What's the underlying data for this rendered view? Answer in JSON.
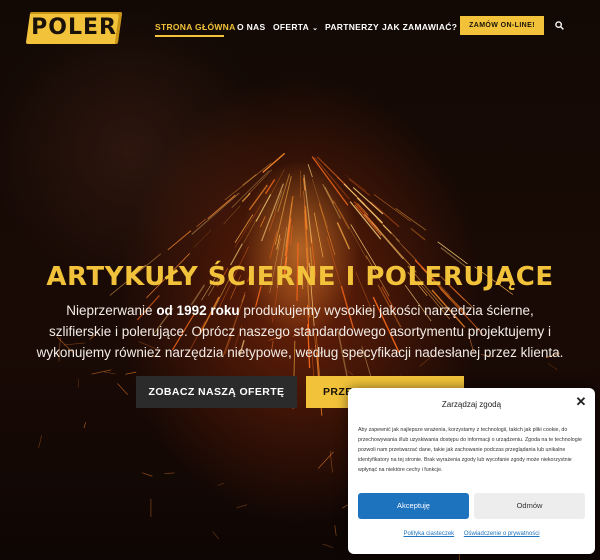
{
  "header": {
    "logo_text": "POLER",
    "nav": [
      {
        "label": "STRONA GŁÓWNA",
        "active": true
      },
      {
        "label": "O NAS"
      },
      {
        "label": "OFERTA",
        "has_dropdown": true
      },
      {
        "label": "PARTNERZY"
      },
      {
        "label": "JAK ZAMAWIAĆ?"
      }
    ],
    "order_button": "ZAMÓW ON-LINE!",
    "search_icon": "search-icon"
  },
  "hero": {
    "title": "ARTYKUŁY ŚCIERNE I POLERUJĄCE",
    "desc_before": "Nieprzerwanie ",
    "desc_bold": "od 1992 roku",
    "desc_after": " produkujemy wysokiej jakości narzędzia ścierne, szlifierskie i polerujące. Oprócz naszego standardowego asortymentu projektujemy i wykonujemy również narzędzia nietypowe, według specyfikacji nadesłanej przez klienta.",
    "button_offer": "ZOBACZ NASZĄ OFERTĘ",
    "button_second": "PRZE"
  },
  "consent": {
    "title": "Zarządzaj zgodą",
    "text": "Aby zapewnić jak najlepsze wrażenia, korzystamy z technologii, takich jak pliki cookie, do przechowywania i/lub uzyskiwania dostępu do informacji o urządzeniu. Zgoda na te technologie pozwoli nam przetwarzać dane, takie jak zachowanie podczas przeglądania lub unikalne identyfikatory na tej stronie. Brak wyrażenia zgody lub wycofanie zgody może niekorzystnie wpłynąć na niektóre cechy i funkcje.",
    "accept": "Akceptuję",
    "deny": "Odmów",
    "link_cookies": "Polityka ciasteczek",
    "link_privacy": "Oświadczenie o prywatności"
  },
  "colors": {
    "accent": "#f2c33a",
    "consent_primary": "#1e73be"
  }
}
